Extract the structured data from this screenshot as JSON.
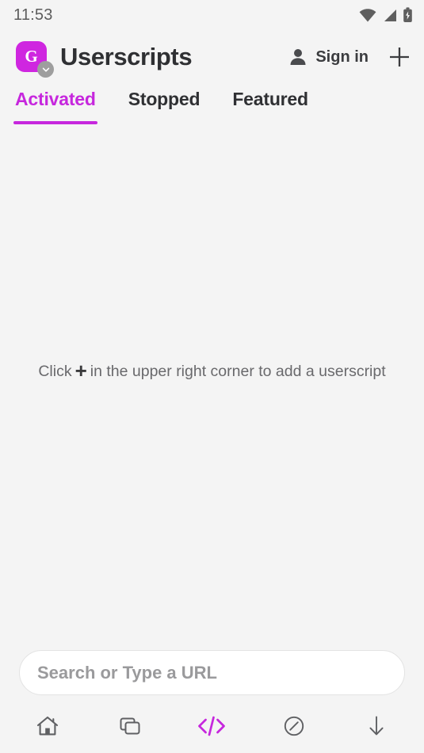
{
  "status_bar": {
    "time": "11:53",
    "icons": [
      "wifi-icon",
      "signal-icon",
      "battery-charging-icon"
    ]
  },
  "app_bar": {
    "logo_letter": "G",
    "logo_color": "#cf26e0",
    "logo_badge_icon": "chevron-down-icon",
    "title": "Userscripts",
    "sign_in_label": "Sign in",
    "account_icon": "person-icon",
    "add_icon": "plus-icon"
  },
  "tabs": [
    {
      "label": "Activated",
      "active": true
    },
    {
      "label": "Stopped",
      "active": false
    },
    {
      "label": "Featured",
      "active": false
    }
  ],
  "empty_state": {
    "prefix": "Click",
    "plus_glyph": "+",
    "suffix": "in the upper right corner to add a userscript"
  },
  "url_bar": {
    "value": "",
    "placeholder": "Search or Type a URL"
  },
  "bottom_nav": [
    {
      "name": "home-icon",
      "active": false
    },
    {
      "name": "tabs-icon",
      "active": false
    },
    {
      "name": "code-icon",
      "active": true
    },
    {
      "name": "block-icon",
      "active": false
    },
    {
      "name": "downloads-icon",
      "active": false
    }
  ],
  "colors": {
    "accent": "#c627dd",
    "background": "#f4f4f4",
    "text": "#2f3033",
    "muted": "#69696c"
  }
}
